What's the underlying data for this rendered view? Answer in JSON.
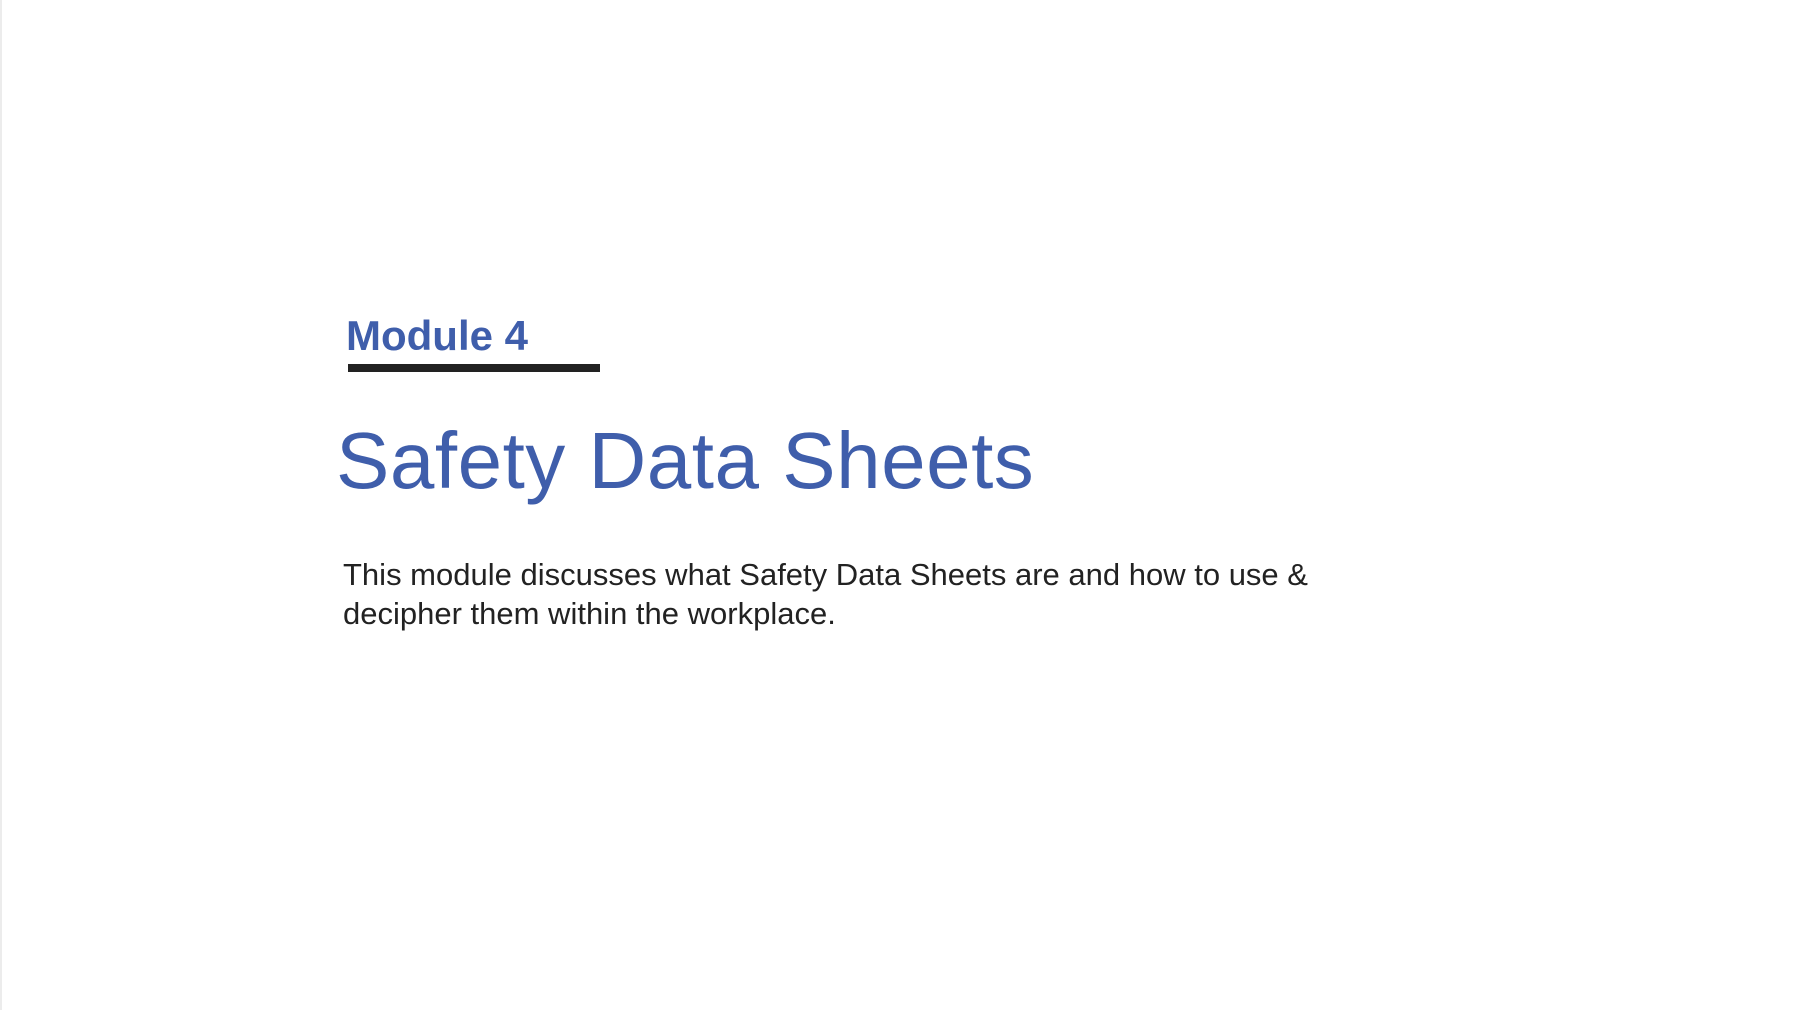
{
  "slide": {
    "module_label": "Module 4",
    "title": "Safety Data Sheets",
    "description": "This module discusses what Safety Data Sheets are and how to use & decipher them within the workplace."
  },
  "colors": {
    "accent": "#3f5eab",
    "text": "#222222",
    "underline": "#222222",
    "background": "#ffffff"
  }
}
